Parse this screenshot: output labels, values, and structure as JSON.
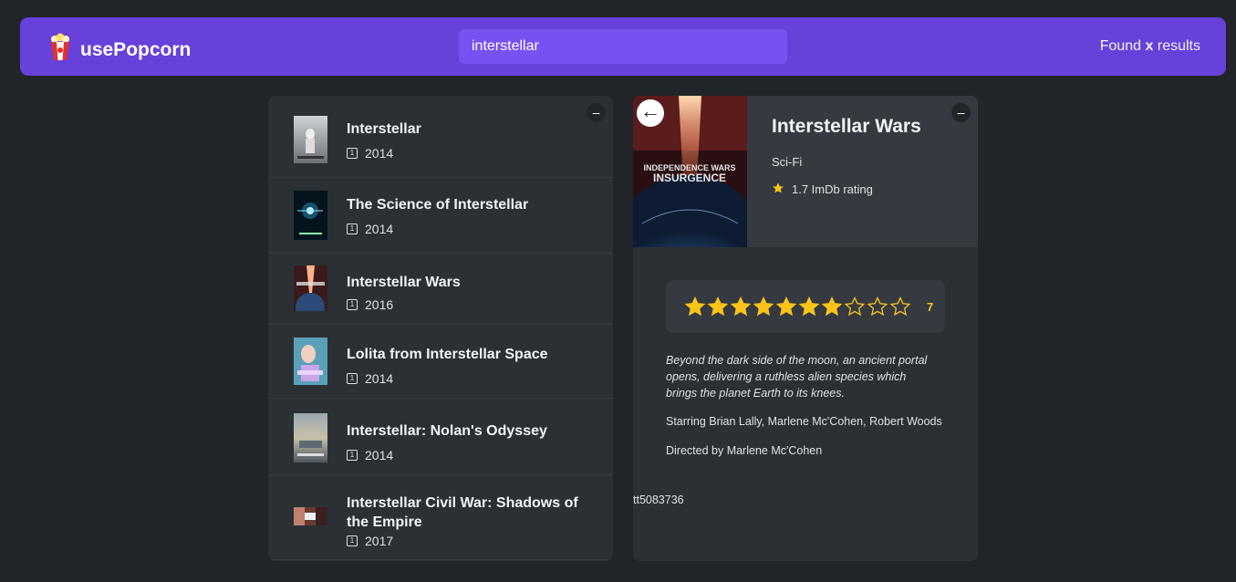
{
  "nav": {
    "logo_text": "usePopcorn",
    "search_value": "interstellar",
    "found_prefix": "Found ",
    "found_count": "x",
    "found_suffix": " results"
  },
  "list": {
    "toggle": "–",
    "movies": [
      {
        "title": "Interstellar",
        "year": "2014"
      },
      {
        "title": "The Science of Interstellar",
        "year": "2014"
      },
      {
        "title": "Interstellar Wars",
        "year": "2016"
      },
      {
        "title": "Lolita from Interstellar Space",
        "year": "2014"
      },
      {
        "title": "Interstellar: Nolan's Odyssey",
        "year": "2014"
      },
      {
        "title": "Interstellar Civil War: Shadows of the Empire",
        "year": "2017"
      }
    ]
  },
  "detail": {
    "toggle": "–",
    "back": "←",
    "title": "Interstellar Wars",
    "genre": "Sci-Fi",
    "imdb_rating": "1.7 ImDb rating",
    "user_rating": 7,
    "user_rating_label": "7",
    "max_rating": 10,
    "poster_text_1": "INDEPENDENCE WARS",
    "poster_text_2": "INSURGENCE",
    "plot": "Beyond the dark side of the moon, an ancient portal opens, delivering a ruthless alien species which brings the planet Earth to its knees.",
    "starring": "Starring Brian Lally, Marlene Mc'Cohen, Robert Woods",
    "directed": "Directed by Marlene Mc'Cohen",
    "imdb_id": "tt5083736"
  },
  "colors": {
    "primary": "#6741d9",
    "primary_light": "#7950f2",
    "background": "#212529",
    "box": "#2b3035",
    "star": "#fcc419"
  }
}
